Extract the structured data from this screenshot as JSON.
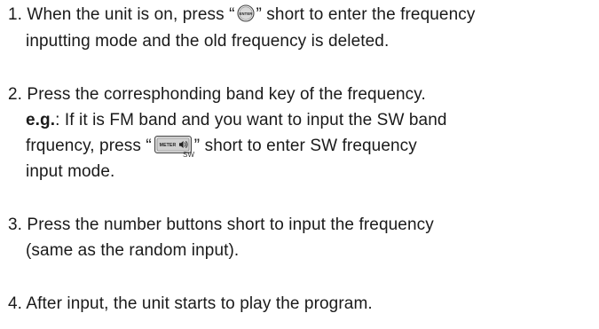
{
  "steps": {
    "s1": {
      "line1_a": "1. When the unit is on, press  “",
      "icon_label": "ENTER",
      "line1_b": "” short to enter the frequency",
      "line2": "inputting mode and the old frequency is deleted."
    },
    "s2": {
      "line1": "2. Press the corresphonding band key of the frequency.",
      "eg_label": "e.g.",
      "line2_rest": ": If it is FM band and you want to input the SW band",
      "line3_a": "frquency, press  “",
      "icon_label": "METER",
      "icon_sub": "SW",
      "line3_b": "”  short to enter SW frequency",
      "line4": "input mode."
    },
    "s3": {
      "line1": "3. Press the number buttons short to input the frequency",
      "line2": "(same as the random input)."
    },
    "s4": {
      "line1": "4. After input, the unit starts to play the program."
    }
  },
  "icons": {
    "enter": "enter-button-icon",
    "meter": "meter-sw-button-icon"
  }
}
